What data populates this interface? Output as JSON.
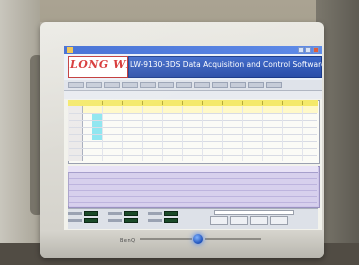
{
  "window": {
    "logo_text": "LONG WIN",
    "app_title": "LW-9130-3DS Data Acquisition and Control Software"
  },
  "monitor": {
    "brand": "BenQ"
  },
  "colors": {
    "titlebar": "#2f5fd0",
    "logo_red": "#d42a2a",
    "grid_header_yellow": "#f4e96a",
    "lower_grid_lavender": "#cfc6ea",
    "indicator_green": "#1a4a28",
    "selected_cell_cyan": "#8fe6f0",
    "power_led_blue": "#3a7dff"
  },
  "icons": [
    "app-icon",
    "minimize-icon",
    "maximize-icon",
    "close-icon",
    "power-icon"
  ]
}
